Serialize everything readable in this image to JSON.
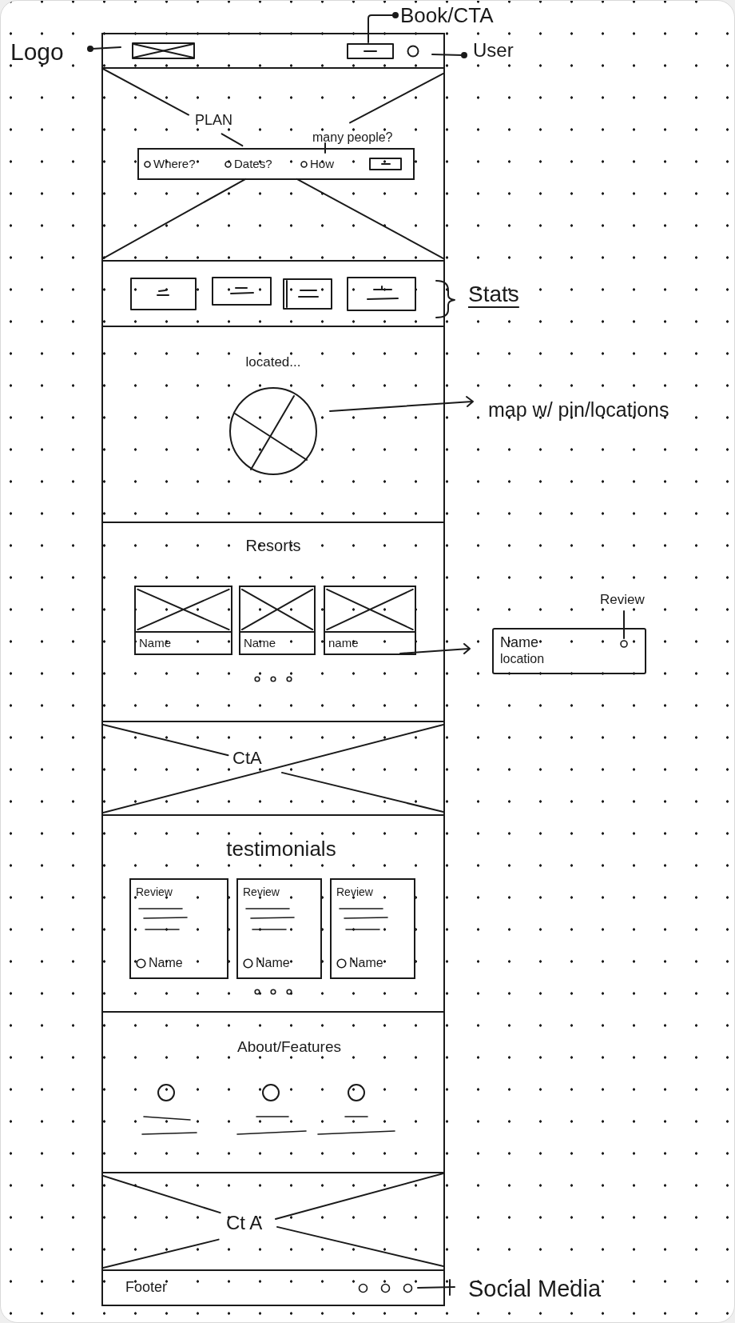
{
  "header": {
    "logo_note": "Logo",
    "cta_note": "Book/CTA",
    "user_note": "User"
  },
  "hero": {
    "title": "PLAN",
    "note": "many people?",
    "search_fields": [
      {
        "label": "Where?"
      },
      {
        "label": "Dates?"
      },
      {
        "label": "How"
      }
    ]
  },
  "stats": {
    "note": "Stats"
  },
  "location": {
    "title": "located...",
    "note": "map w/ pin/locations"
  },
  "resorts": {
    "title": "Resorts",
    "cards": [
      {
        "name": "Name"
      },
      {
        "name": "Name"
      },
      {
        "name": "name"
      }
    ],
    "detail_card": {
      "review_note": "Review",
      "name": "Name",
      "location": "location"
    }
  },
  "cta_banner": {
    "label": "CtA"
  },
  "testimonials": {
    "title": "testimonials",
    "cards": [
      {
        "heading": "Review",
        "author": "Name"
      },
      {
        "heading": "Review",
        "author": "Name"
      },
      {
        "heading": "Review",
        "author": "Name"
      }
    ]
  },
  "features": {
    "title": "About/Features"
  },
  "closing_banner": {
    "label": "Ct A"
  },
  "footer": {
    "label": "Footer",
    "note": "Social Media"
  }
}
